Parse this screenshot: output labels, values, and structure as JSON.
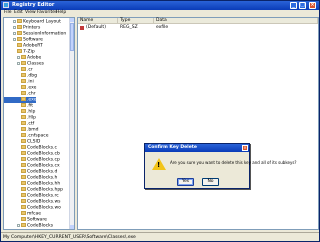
{
  "window": {
    "title": "Registry Editor",
    "buttons": {
      "minimize": "_",
      "maximize": "□",
      "close": "×"
    }
  },
  "menubar": [
    "File",
    "Edit",
    "View",
    "Favorites",
    "Help"
  ],
  "tree": [
    {
      "label": "Keyboard Layout",
      "indent": 2,
      "expander": true
    },
    {
      "label": "Printers",
      "indent": 2,
      "expander": true
    },
    {
      "label": "SessionInformation",
      "indent": 2,
      "expander": true
    },
    {
      "label": "Software",
      "indent": 2,
      "expander": true
    },
    {
      "label": "AdobeRT",
      "indent": 3,
      "expander": false
    },
    {
      "label": "7-Zip",
      "indent": 3,
      "expander": false
    },
    {
      "label": "Adobe",
      "indent": 3,
      "expander": true
    },
    {
      "label": "Classes",
      "indent": 3,
      "expander": true
    },
    {
      "label": ".cr",
      "indent": 4,
      "expander": false
    },
    {
      "label": ".dbg",
      "indent": 4,
      "expander": false
    },
    {
      "label": ".ini",
      "indent": 4,
      "expander": false
    },
    {
      "label": ".exe",
      "indent": 4,
      "expander": false
    },
    {
      "label": ".chr",
      "indent": 4,
      "expander": false
    },
    {
      "label": ".exe",
      "indent": 4,
      "expander": false,
      "selected": true
    },
    {
      "label": ".fit",
      "indent": 4,
      "expander": false
    },
    {
      "label": ".hlp",
      "indent": 4,
      "expander": false
    },
    {
      "label": ".Hlp",
      "indent": 4,
      "expander": false
    },
    {
      "label": ".ctf",
      "indent": 4,
      "expander": false
    },
    {
      "label": ".bmd",
      "indent": 4,
      "expander": false
    },
    {
      "label": ".cnfspace",
      "indent": 4,
      "expander": false
    },
    {
      "label": "CLSID",
      "indent": 4,
      "expander": false
    },
    {
      "label": "CodeBlocks.c",
      "indent": 4,
      "expander": false
    },
    {
      "label": "CodeBlocks.cb",
      "indent": 4,
      "expander": false
    },
    {
      "label": "CodeBlocks.cp",
      "indent": 4,
      "expander": false
    },
    {
      "label": "CodeBlocks.cx",
      "indent": 4,
      "expander": false
    },
    {
      "label": "CodeBlocks.d",
      "indent": 4,
      "expander": false
    },
    {
      "label": "CodeBlocks.h",
      "indent": 4,
      "expander": false
    },
    {
      "label": "CodeBlocks.hh",
      "indent": 4,
      "expander": false
    },
    {
      "label": "CodeBlocks.hpp",
      "indent": 4,
      "expander": false
    },
    {
      "label": "CodeBlocks.rc",
      "indent": 4,
      "expander": false
    },
    {
      "label": "CodeBlocks.ws",
      "indent": 4,
      "expander": false
    },
    {
      "label": "CodeBlocks.wo",
      "indent": 4,
      "expander": false
    },
    {
      "label": "mfcae",
      "indent": 4,
      "expander": false
    },
    {
      "label": "Software",
      "indent": 4,
      "expander": false
    },
    {
      "label": "CodeBlocks",
      "indent": 3,
      "expander": true
    }
  ],
  "list": {
    "columns": [
      "Name",
      "Type",
      "Data"
    ],
    "rows": [
      {
        "name": "(Default)",
        "type": "REG_SZ",
        "data": "exfile"
      }
    ]
  },
  "status": "My Computer\\HKEY_CURRENT_USER\\Software\\Classes\\.exe",
  "dialog": {
    "title": "Confirm Key Delete",
    "message": "Are you sure you want to delete this key and all of its subkeys?",
    "yes": "Yes",
    "no": "No",
    "close": "×",
    "warning_mark": "!"
  }
}
